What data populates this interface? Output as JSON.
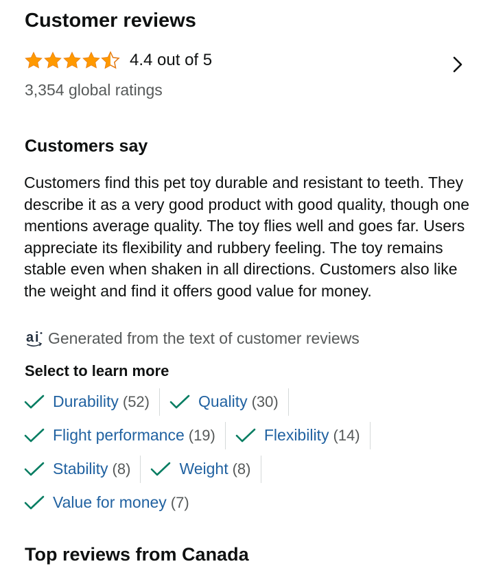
{
  "header": {
    "title": "Customer reviews"
  },
  "rating": {
    "stars_value": 4.4,
    "text": "4.4 out of 5",
    "global_ratings": "3,354 global ratings",
    "star_color": "#ff9900"
  },
  "customers_say": {
    "title": "Customers say",
    "summary": "Customers find this pet toy durable and resistant to teeth. They describe it as a very good product with good quality, though one mentions average quality. The toy flies well and goes far. Users appreciate its flexibility and rubbery feeling. The toy remains stable even when shaken in all directions. Customers also like the weight and find it offers good value for money.",
    "ai_note": "Generated from the text of customer reviews"
  },
  "learn_more": {
    "title": "Select to learn more",
    "aspects": [
      {
        "name": "Durability",
        "count": "(52)"
      },
      {
        "name": "Quality",
        "count": "(30)"
      },
      {
        "name": "Flight performance",
        "count": "(19)"
      },
      {
        "name": "Flexibility",
        "count": "(14)"
      },
      {
        "name": "Stability",
        "count": "(8)"
      },
      {
        "name": "Weight",
        "count": "(8)"
      },
      {
        "name": "Value for money",
        "count": "(7)"
      }
    ]
  },
  "top_reviews": {
    "title": "Top reviews from Canada"
  },
  "colors": {
    "link": "#2162a1",
    "check": "#067d62",
    "muted": "#565959"
  },
  "icons": {
    "star": "star-icon",
    "half_star": "half-star-icon",
    "chevron": "chevron-right-icon",
    "check": "checkmark-icon",
    "ai": "ai-icon"
  }
}
